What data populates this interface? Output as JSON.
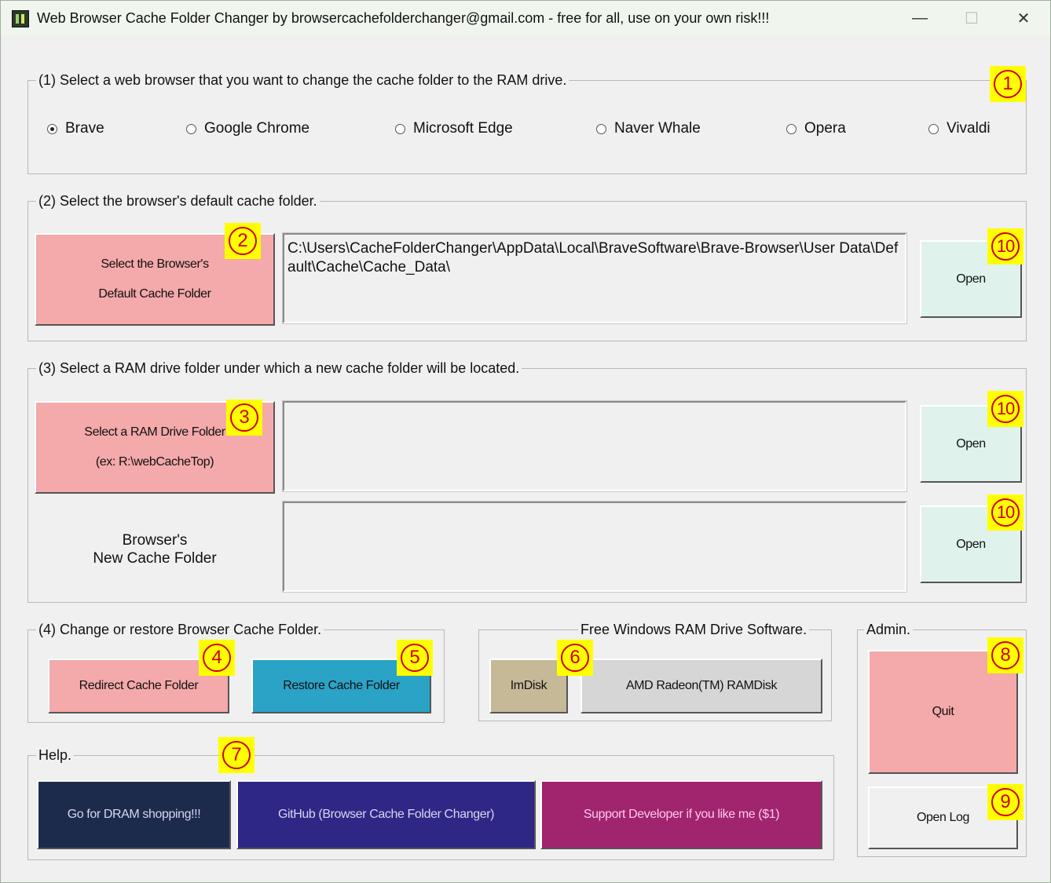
{
  "window": {
    "title": "Web Browser Cache Folder Changer by browsercachefolderchanger@gmail.com - free for all, use on your own risk!!!",
    "minimize": "—",
    "maximize": "☐",
    "close": "✕"
  },
  "step1": {
    "legend": "(1) Select a web browser that you want to change the cache folder to the RAM drive.",
    "browsers": [
      "Brave",
      "Google Chrome",
      "Microsoft Edge",
      "Naver Whale",
      "Opera",
      "Vivaldi"
    ],
    "selected": "Brave"
  },
  "step2": {
    "legend": "(2) Select the browser's default cache folder.",
    "select_button_line1": "Select the Browser's",
    "select_button_line2": "Default Cache Folder",
    "path": "C:\\Users\\CacheFolderChanger\\AppData\\Local\\BraveSoftware\\Brave-Browser\\User Data\\Default\\Cache\\Cache_Data\\",
    "open_label": "Open"
  },
  "step3": {
    "legend": "(3) Select a RAM drive folder under which a new cache folder will be located.",
    "select_button_line1": "Select a RAM Drive Folder",
    "select_button_line2": "(ex: R:\\webCacheTop)",
    "ram_path": "",
    "new_folder_label_line1": "Browser's",
    "new_folder_label_line2": "New Cache Folder",
    "new_folder_path": "",
    "open_label_1": "Open",
    "open_label_2": "Open"
  },
  "step4": {
    "legend": "(4) Change or restore Browser Cache Folder.",
    "redirect_label": "Redirect Cache Folder",
    "restore_label": "Restore Cache Folder"
  },
  "ramdrive": {
    "legend": "Free Windows RAM Drive Software.",
    "imdisk_label": "ImDisk",
    "amd_label": "AMD Radeon(TM) RAMDisk"
  },
  "admin": {
    "legend": "Admin.",
    "quit_label": "Quit",
    "open_log_label": "Open Log"
  },
  "help": {
    "legend": "Help.",
    "dram_label": "Go for DRAM shopping!!!",
    "github_label": "GitHub (Browser Cache Folder Changer)",
    "support_label": "Support Developer if you like me ($1)"
  },
  "badges": {
    "b1": "1",
    "b2": "2",
    "b3": "3",
    "b4": "4",
    "b5": "5",
    "b6": "6",
    "b7": "7",
    "b8": "8",
    "b9": "9",
    "b10": "10"
  },
  "colors": {
    "pink": "#f4a9aa",
    "mint": "#dff3ec",
    "teal": "#2aa3c6",
    "khaki": "#c6b998",
    "navy": "#1c2a4c",
    "indigo": "#2e2785",
    "plum": "#a0246e",
    "badge_yellow": "#ffff00",
    "badge_red": "#d00000"
  }
}
